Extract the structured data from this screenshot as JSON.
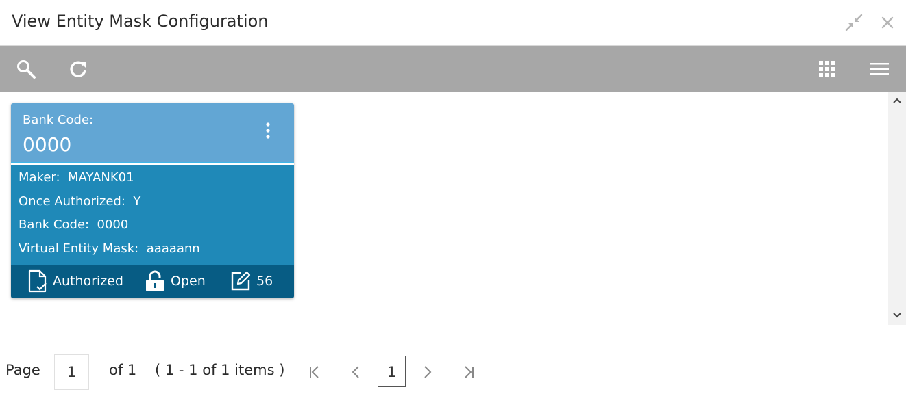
{
  "window": {
    "title": "View Entity Mask Configuration",
    "minimize_icon": "collapse-arrows-icon",
    "close_icon": "close-icon"
  },
  "toolbar": {
    "search_icon": "search-icon",
    "refresh_icon": "refresh-icon",
    "grid_view_icon": "grid-icon",
    "list_view_icon": "hamburger-icon"
  },
  "card": {
    "header_key": "Bank Code:",
    "header_value": "0000",
    "fields": [
      {
        "label": "Maker:",
        "value": "MAYANK01"
      },
      {
        "label": "Once Authorized:",
        "value": "Y"
      },
      {
        "label": "Bank Code:",
        "value": "0000"
      },
      {
        "label": "Virtual Entity Mask:",
        "value": "aaaaann"
      }
    ],
    "footer": {
      "auth_status": "Authorized",
      "record_status": "Open",
      "mod_count": "56"
    },
    "colors": {
      "header": "#62a6d4",
      "body": "#1f89b8",
      "footer": "#075c84"
    }
  },
  "pagination": {
    "page_label": "Page",
    "page_input_value": "1",
    "of_label": "of 1",
    "items_summary": "( 1 - 1 of 1 items )",
    "current_page": "1"
  }
}
